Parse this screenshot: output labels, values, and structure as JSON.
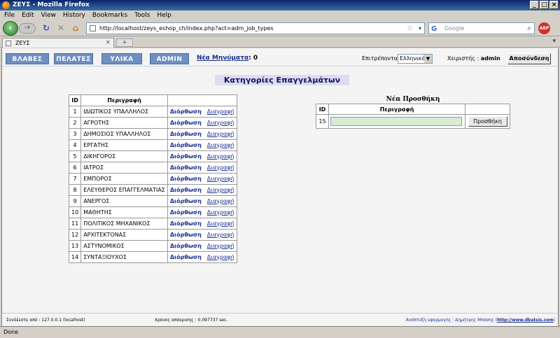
{
  "window": {
    "title": "ΖΕΥΣ - Mozilla Firefox",
    "controls": [
      "_",
      "□",
      "×"
    ]
  },
  "menubar": [
    "File",
    "Edit",
    "View",
    "History",
    "Bookmarks",
    "Tools",
    "Help"
  ],
  "browser": {
    "url": "http://localhost/zeys_eshop_ch/index.php?act=adm_job_types",
    "search_placeholder": "Google",
    "tab_title": "ΖΕΥΣ",
    "new_tab": "+",
    "status": "Done"
  },
  "topnav": {
    "buttons": [
      "ΒΛΑΒΕΣ",
      "ΠΕΛΑΤΕΣ",
      "ΥΛΙΚΑ",
      "ADMIN"
    ],
    "messages_label": "Νέα Μηνύματα",
    "messages_count": ": 0",
    "lang_label": "Επιτρέπονται :",
    "lang_value": "Ελληνικά",
    "user_label": "Χειριστής :",
    "user_name": "admin",
    "logout_label": "Αποσύνδεση"
  },
  "page_title": "Κατηγορίες Επαγγελμάτων",
  "categories": {
    "headers": [
      "ID",
      "Περιγραφή",
      ""
    ],
    "edit_label": "Διόρθωση",
    "delete_label": "Διαγραφή",
    "rows": [
      {
        "id": "1",
        "desc": "ΙΔΙΩΤΙΚΟΣ ΥΠΑΛΛΗΛΟΣ"
      },
      {
        "id": "2",
        "desc": "ΑΓΡΟΤΗΣ"
      },
      {
        "id": "3",
        "desc": "ΔΗΜΟΣΙΟΣ ΥΠΑΛΛΗΛΟΣ"
      },
      {
        "id": "4",
        "desc": "ΕΡΓΑΤΗΣ"
      },
      {
        "id": "5",
        "desc": "ΔΙΚΗΓΟΡΟΣ"
      },
      {
        "id": "6",
        "desc": "ΙΑΤΡΟΣ"
      },
      {
        "id": "7",
        "desc": "ΕΜΠΟΡΟΣ"
      },
      {
        "id": "8",
        "desc": "ΕΛΕΥΘΕΡΟΣ ΕΠΑΓΓΕΛΜΑΤΙΑΣ"
      },
      {
        "id": "9",
        "desc": "ΑΝΕΡΓΟΣ"
      },
      {
        "id": "10",
        "desc": "ΜΑΘΗΤΗΣ"
      },
      {
        "id": "11",
        "desc": "ΠΟΛΙΤΙΚΟΣ ΜΗΧΑΝΙΚΟΣ"
      },
      {
        "id": "12",
        "desc": "ΑΡΧΙΤΕΚΤΟΝΑΣ"
      },
      {
        "id": "13",
        "desc": "ΑΣΤΥΝΟΜΙΚΟΣ"
      },
      {
        "id": "14",
        "desc": "ΣΥΝΤΑΞΙΟΥΧΟΣ"
      }
    ]
  },
  "new_entry": {
    "title": "Νέα Προσθήκη",
    "headers": [
      "ID",
      "Περιγραφή",
      ""
    ],
    "next_id": "15",
    "input_value": "",
    "add_label": "Προσθήκη"
  },
  "footer": {
    "connected": "Συνδέεστε από : 127.0.0.1 (localhost)",
    "response_time": "Χρόνος απόκρισης : 0.097737 sec.",
    "dev_label": "Ανάπτυξη εφαρμογής : Δημήτρης Μπόσης (",
    "dev_link": "http://www.dbatsis.com",
    "dev_close": ")"
  }
}
